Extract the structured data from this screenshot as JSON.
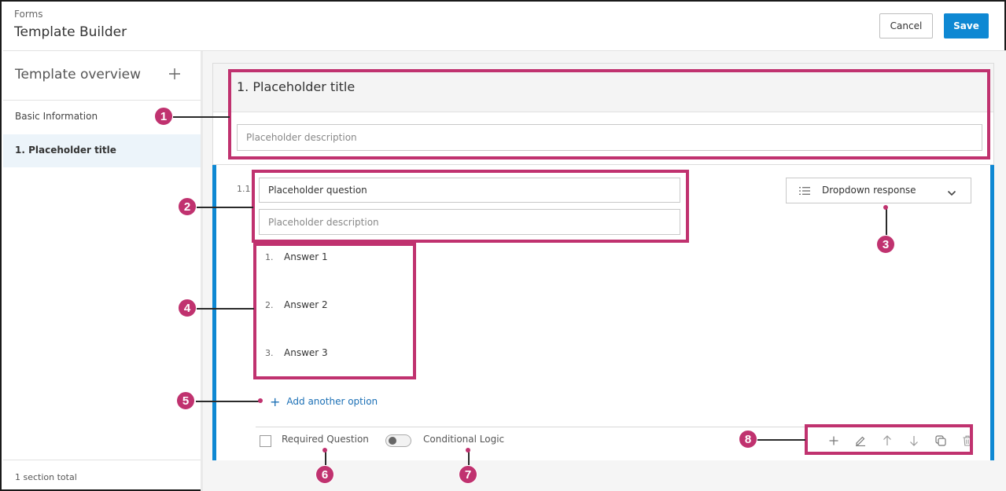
{
  "header": {
    "breadcrumb": "Forms",
    "title": "Template Builder",
    "cancel_label": "Cancel",
    "save_label": "Save"
  },
  "sidebar": {
    "title": "Template overview",
    "add_icon": "plus-icon",
    "items": [
      {
        "label": "Basic Information",
        "selected": false
      },
      {
        "label": "1. Placeholder title",
        "selected": true
      }
    ],
    "footer": "1 section total"
  },
  "section": {
    "title": "1.  Placeholder title",
    "description_placeholder": "Placeholder description"
  },
  "question": {
    "number": "1.1",
    "text": "Placeholder question",
    "description_placeholder": "Placeholder description",
    "response_type": "Dropdown response",
    "answers": [
      {
        "num": "1.",
        "label": "Answer 1"
      },
      {
        "num": "2.",
        "label": "Answer 2"
      },
      {
        "num": "3.",
        "label": "Answer 3"
      }
    ],
    "add_option_label": "Add another option",
    "required_label": "Required Question",
    "required_checked": false,
    "conditional_label": "Conditional Logic",
    "conditional_on": false,
    "tools": [
      "plus-icon",
      "pencil-icon",
      "arrow-up-icon",
      "arrow-down-icon",
      "duplicate-icon",
      "trash-icon"
    ]
  },
  "annotations": {
    "color": "#c0326f",
    "callouts": [
      "1",
      "2",
      "3",
      "4",
      "5",
      "6",
      "7",
      "8"
    ]
  },
  "colors": {
    "accent": "#0e88d3",
    "link": "#1b6fb5"
  }
}
